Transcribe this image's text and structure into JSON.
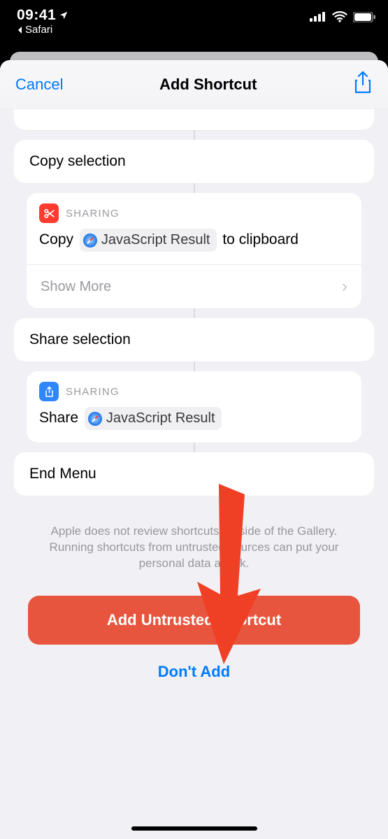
{
  "status": {
    "time": "09:41",
    "back_app": "Safari"
  },
  "sheet": {
    "cancel": "Cancel",
    "title": "Add Shortcut"
  },
  "blocks": {
    "copy_section_title": "Copy selection",
    "share_section_title": "Share selection",
    "end_menu": "End Menu",
    "sharing_label": "SHARING",
    "copy_prefix": "Copy",
    "copy_suffix_1": "to",
    "copy_suffix_2": "clipboard",
    "share_prefix": "Share",
    "pill_label": "JavaScript Result",
    "show_more": "Show More"
  },
  "footer": {
    "warning": "Apple does not review shortcuts outside of the Gallery. Running shortcuts from untrusted sources can put your personal data at risk.",
    "primary": "Add Untrusted Shortcut",
    "secondary": "Don't Add"
  }
}
